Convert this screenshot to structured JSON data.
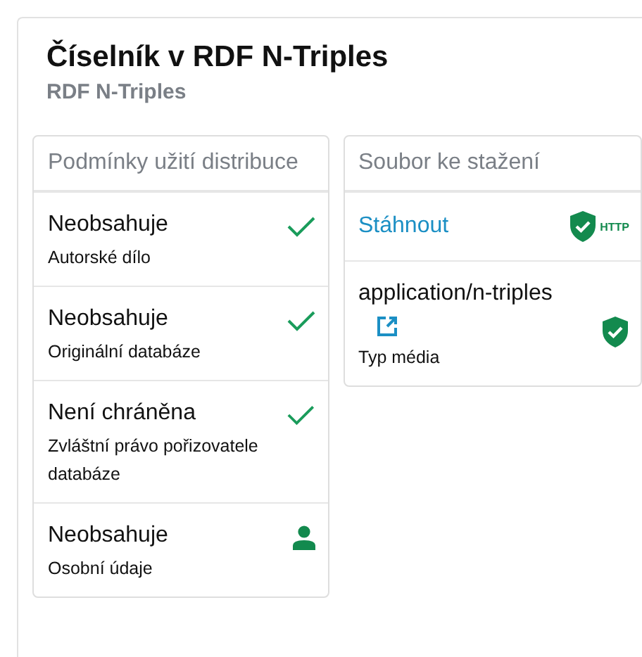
{
  "title": "Číselník v RDF N-Triples",
  "subtitle": "RDF N-Triples",
  "terms": {
    "heading": "Podmínky užití distribuce",
    "items": [
      {
        "value": "Neobsahuje",
        "label": "Autorské dílo",
        "kind": "check"
      },
      {
        "value": "Neobsahuje",
        "label": "Originální databáze",
        "kind": "check"
      },
      {
        "value": "Není chráněna",
        "label": "Zvláštní právo pořizovatele databáze",
        "kind": "check"
      },
      {
        "value": "Neobsahuje",
        "label": "Osobní údaje",
        "kind": "person"
      }
    ]
  },
  "download": {
    "heading": "Soubor ke stažení",
    "link": "Stáhnout",
    "badge": "HTTP",
    "media_type": "application/n-triples",
    "media_label": "Typ média"
  }
}
